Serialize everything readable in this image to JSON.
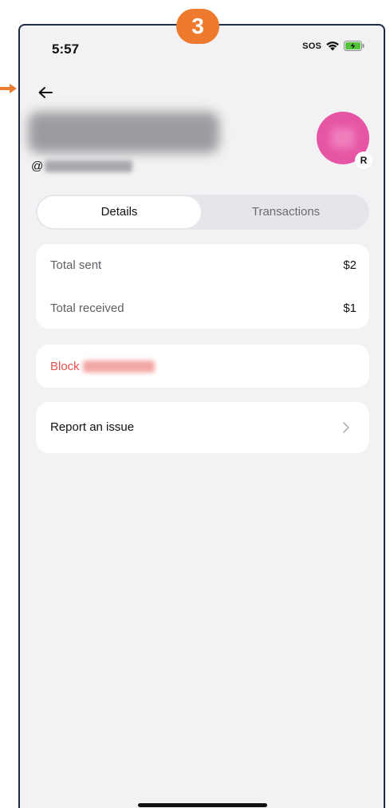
{
  "annotation": {
    "step_number": "3",
    "accent_color": "#ee7a2d"
  },
  "status_bar": {
    "time": "5:57",
    "sos_label": "SOS"
  },
  "header": {
    "back_icon": "arrow-left-icon",
    "handle_prefix": "@",
    "avatar_badge": "R",
    "avatar_color": "#e655a3"
  },
  "tabs": [
    {
      "label": "Details",
      "active": true
    },
    {
      "label": "Transactions",
      "active": false
    }
  ],
  "totals": {
    "sent_label": "Total sent",
    "sent_value": "$2",
    "received_label": "Total received",
    "received_value": "$1"
  },
  "block": {
    "label": "Block",
    "color": "#e5534b"
  },
  "report": {
    "label": "Report an issue",
    "icon": "chevron-right-icon"
  }
}
